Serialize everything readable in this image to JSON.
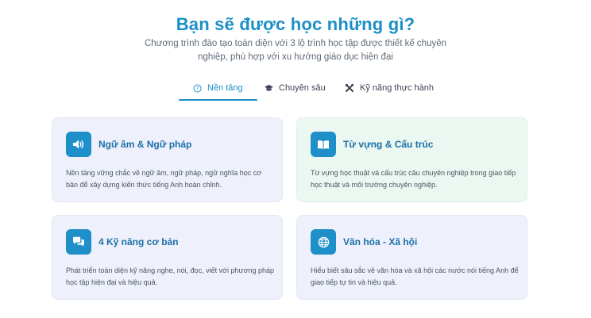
{
  "header": {
    "title": "Bạn sẽ được học những gì?",
    "subtitle": "Chương trình đào tạo toàn diện với 3 lộ trình học tập được thiết kế chuyên nghiệp, phù hợp với xu hướng giáo dục hiện đại"
  },
  "tabs": [
    {
      "label": "Nền tảng",
      "icon": "question-circle-icon",
      "active": true
    },
    {
      "label": "Chuyên sâu",
      "icon": "graduation-cap-icon",
      "active": false
    },
    {
      "label": "Kỹ năng thực hành",
      "icon": "tools-icon",
      "active": false
    }
  ],
  "cards": [
    {
      "title": "Ngữ âm & Ngữ pháp",
      "icon": "speaker-icon",
      "description": "Nền tảng vững chắc về ngữ âm, ngữ pháp, ngữ nghĩa học cơ bản để xây dựng kiến thức tiếng Anh hoàn chỉnh."
    },
    {
      "title": "Từ vựng & Cấu trúc",
      "icon": "book-icon",
      "description": "Từ vựng học thuật và cấu trúc câu chuyên nghiệp trong giao tiếp học thuật và môi trường chuyên nghiệp."
    },
    {
      "title": "4 Kỹ năng cơ bản",
      "icon": "chat-bubbles-icon",
      "description": "Phát triển toàn diện kỹ năng nghe, nói, đọc, viết với phương pháp học tập hiện đại và hiệu quả."
    },
    {
      "title": "Văn hóa - Xã hội",
      "icon": "globe-icon",
      "description": "Hiểu biết sâu sắc về văn hóa và xã hội các nước nói tiếng Anh để giao tiếp tự tin và hiệu quả."
    }
  ],
  "colors": {
    "accent": "#1b8fc7",
    "icon_bg": "#1e8fc9",
    "card_bg": "#eef1fb",
    "card_green_bg": "#eaf8f1"
  }
}
